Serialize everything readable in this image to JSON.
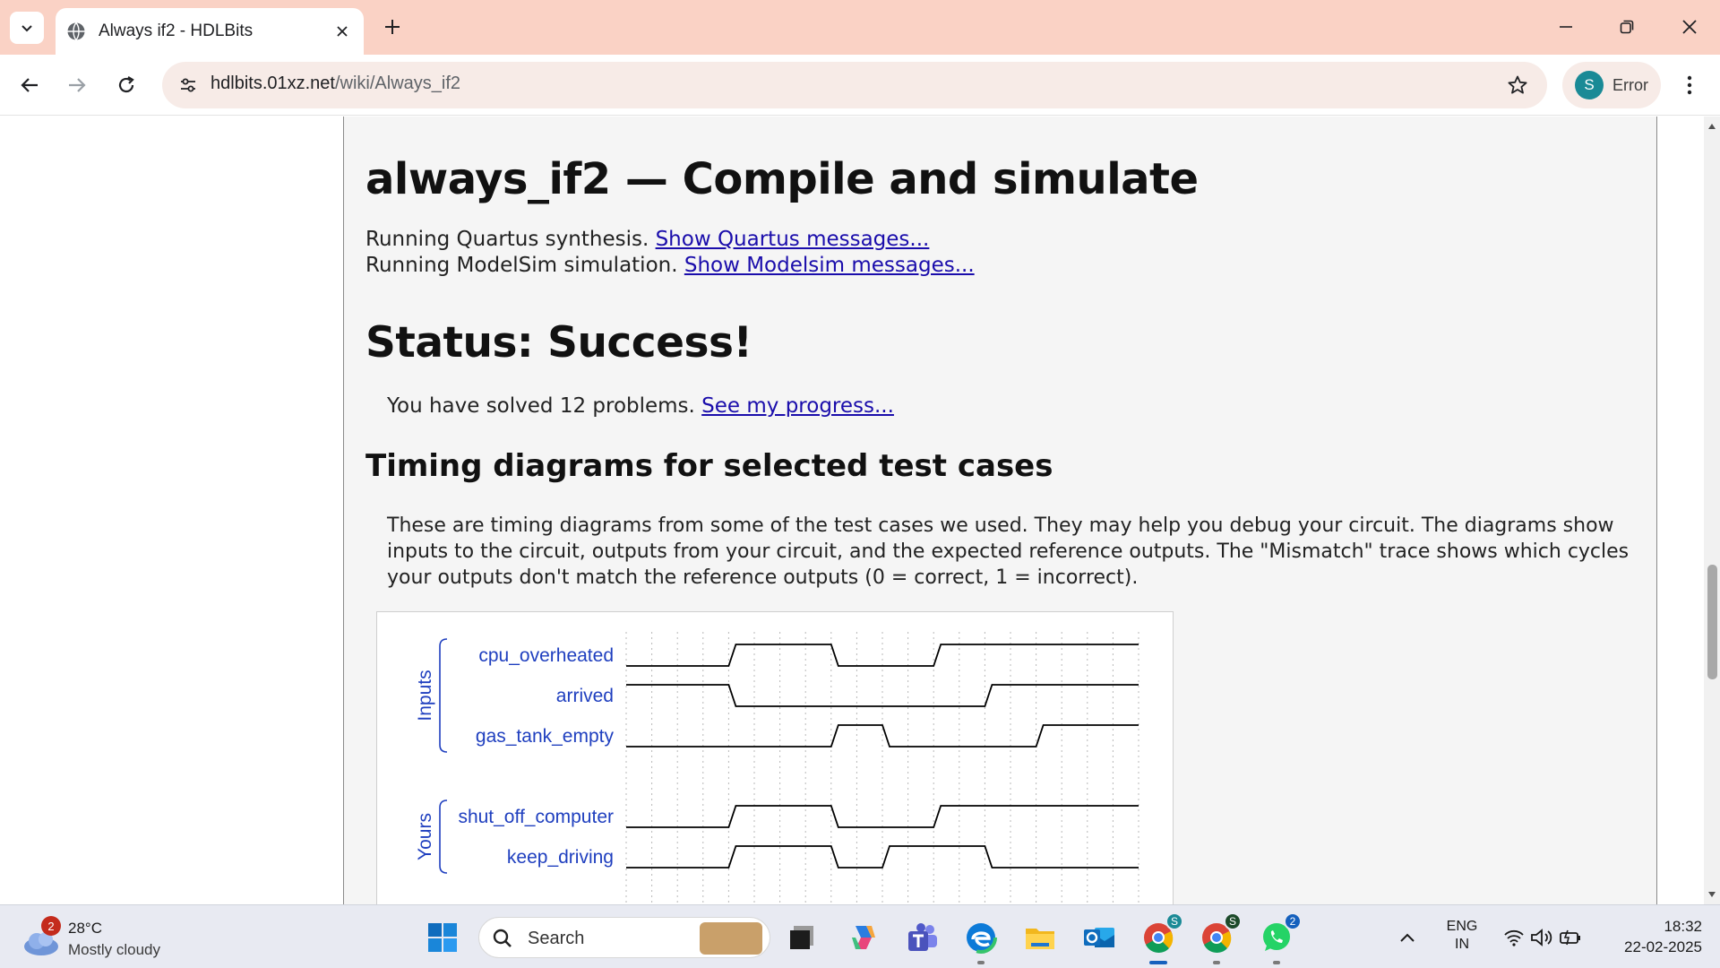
{
  "browser": {
    "tab_title": "Always if2 - HDLBits",
    "url_host": "hdlbits.01xz.net",
    "url_path": "/wiki/Always_if2",
    "profile_initial": "S",
    "profile_label": "Error"
  },
  "page": {
    "title": "always_if2 — Compile and simulate",
    "quartus_text": "Running Quartus synthesis.",
    "quartus_link": "Show Quartus messages...",
    "modelsim_text": "Running ModelSim simulation.",
    "modelsim_link": "Show Modelsim messages...",
    "status": "Status: Success!",
    "solved_text": "You have solved 12 problems.",
    "progress_link": "See my progress...",
    "timing_heading": "Timing diagrams for selected test cases",
    "timing_desc": "These are timing diagrams from some of the test cases we used. They may help you debug your circuit. The diagrams show inputs to the circuit, outputs from your circuit, and the expected reference outputs. The \"Mismatch\" trace shows which cycles your outputs don't match the reference outputs (0 = correct, 1 = incorrect)."
  },
  "timing": {
    "groups": [
      "Inputs",
      "Yours"
    ],
    "signals": [
      {
        "name": "cpu_overheated",
        "group": "Inputs",
        "levels": [
          0,
          0,
          1,
          1,
          0,
          0,
          1,
          1,
          1,
          1
        ]
      },
      {
        "name": "arrived",
        "group": "Inputs",
        "levels": [
          1,
          1,
          0,
          0,
          0,
          0,
          0,
          1,
          1,
          1
        ]
      },
      {
        "name": "gas_tank_empty",
        "group": "Inputs",
        "levels": [
          0,
          0,
          0,
          0,
          1,
          0,
          0,
          0,
          1,
          1
        ]
      },
      {
        "name": "shut_off_computer",
        "group": "Yours",
        "levels": [
          0,
          0,
          1,
          1,
          0,
          0,
          1,
          1,
          1,
          1
        ]
      },
      {
        "name": "keep_driving",
        "group": "Yours",
        "levels": [
          0,
          0,
          1,
          1,
          0,
          1,
          1,
          0,
          0,
          0
        ]
      }
    ],
    "colors": {
      "label": "#1f3fbf",
      "trace": "#000000",
      "grid": "#b8b8b8"
    }
  },
  "taskbar": {
    "weather_badge": "2",
    "temperature": "28°C",
    "condition": "Mostly cloudy",
    "search_placeholder": "Search",
    "chrome_badge": "S",
    "chrome2_badge": "S",
    "whatsapp_badge": "2",
    "lang_line1": "ENG",
    "lang_line2": "IN",
    "time": "18:32",
    "date": "22-02-2025"
  }
}
